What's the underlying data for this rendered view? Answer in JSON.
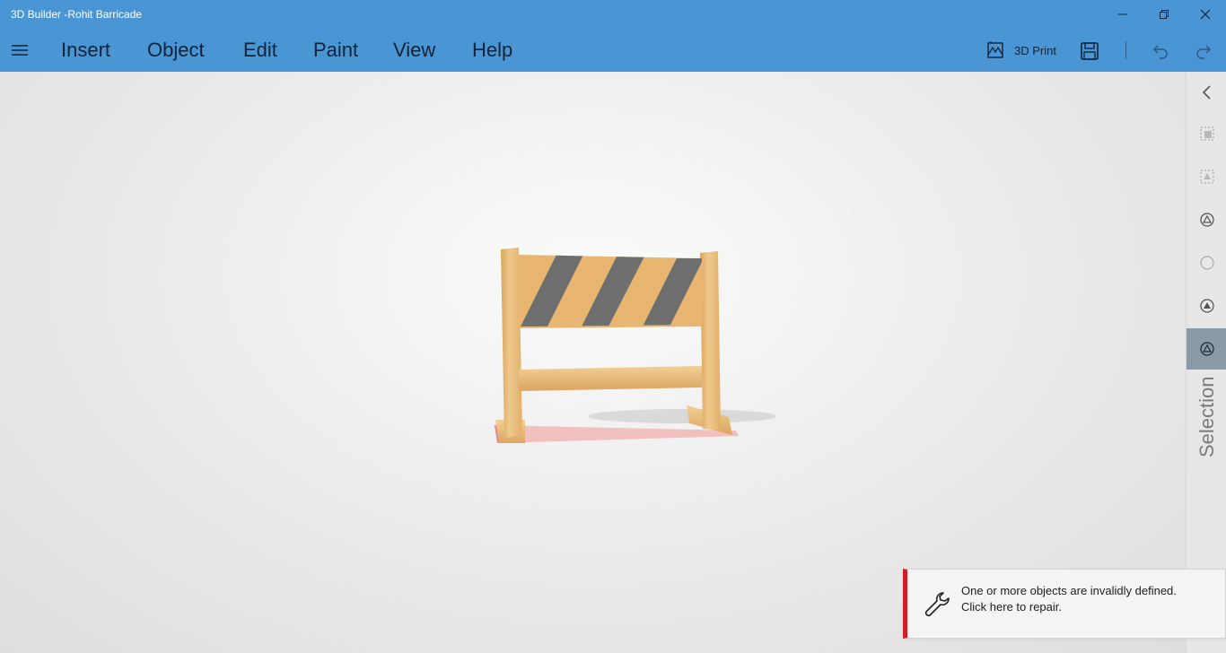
{
  "window": {
    "title": "3D Builder -Rohit Barricade"
  },
  "menu": {
    "items": [
      "Insert",
      "Object",
      "Edit",
      "Paint",
      "View",
      "Help"
    ],
    "print_label": "3D Print"
  },
  "right_panel": {
    "label": "Selection"
  },
  "toast": {
    "line1": "One or more objects are invalidly defined.",
    "line2": "Click here to repair."
  },
  "colors": {
    "accent": "#4a96d4",
    "toast_accent": "#d11f2a",
    "wood": "#e7b56a",
    "stripe": "#6f6f6f"
  },
  "icons": {
    "hamburger": "hamburger-icon",
    "minimize": "minimize-icon",
    "restore": "restore-icon",
    "close": "close-icon",
    "print": "print-icon",
    "save": "save-icon",
    "undo": "undo-icon",
    "redo": "redo-icon",
    "collapse": "chevron-left-icon",
    "repair": "wrench-icon"
  }
}
